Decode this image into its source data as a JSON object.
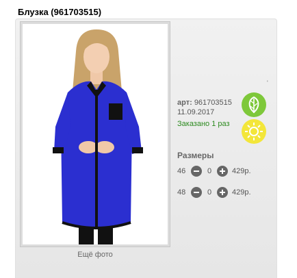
{
  "product": {
    "title": "Блузка (961703515)",
    "more_photo": "Ещё фото",
    "tick": "'",
    "art_label": "арт:",
    "art_value": "961703515",
    "date": "11.09.2017",
    "ordered": "Заказано 1 раз"
  },
  "sizes": {
    "title": "Размеры",
    "rows": [
      {
        "size": "46",
        "qty": "0",
        "price": "429р."
      },
      {
        "size": "48",
        "qty": "0",
        "price": "429р."
      }
    ]
  },
  "icons": {
    "season_badge": "leaf-icon",
    "summer_badge": "sun-icon",
    "minus": "minus-icon",
    "plus": "plus-icon"
  },
  "colors": {
    "green_badge": "#7ec83a",
    "yellow_badge": "#f3e63a",
    "ordered_text": "#2c8a1f"
  }
}
